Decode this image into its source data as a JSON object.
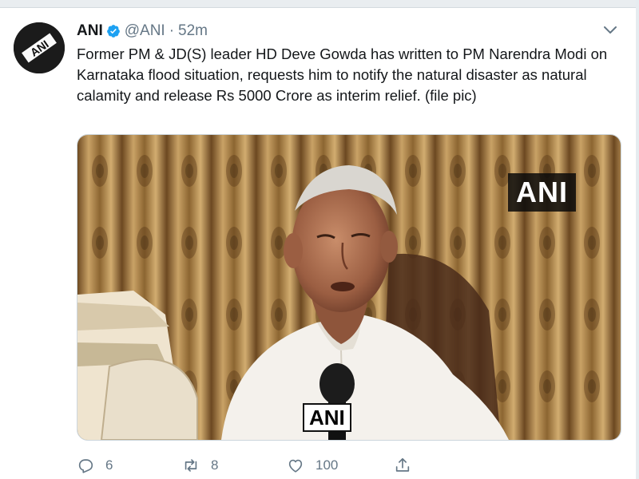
{
  "tweet": {
    "author_name": "ANI",
    "author_handle": "@ANI",
    "separator": "·",
    "timestamp": "52m",
    "avatar_text": "ANI",
    "text": "Former PM & JD(S) leader HD Deve Gowda has written to PM Narendra Modi on Karnataka flood situation, requests him to notify the natural disaster as natural calamity and release Rs 5000 Crore as interim relief. (file pic)",
    "media": {
      "watermark": "ANI",
      "mic_label": "ANI"
    },
    "actions": {
      "reply_count": "6",
      "retweet_count": "8",
      "like_count": "100"
    }
  },
  "colors": {
    "verified": "#1da1f2",
    "muted_text": "#657786",
    "curtain": "#b08a4e",
    "shirt": "#f4f1ec"
  },
  "icons": [
    "verified-badge-icon",
    "chevron-down-icon",
    "reply-icon",
    "retweet-icon",
    "like-icon",
    "share-icon"
  ]
}
